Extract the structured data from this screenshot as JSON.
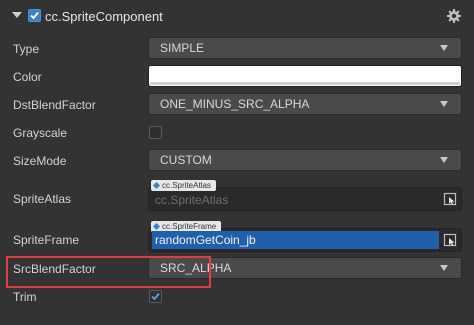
{
  "component": {
    "title": "cc.SpriteComponent",
    "enabled": true
  },
  "properties": {
    "type": {
      "label": "Type",
      "value": "SIMPLE"
    },
    "color": {
      "label": "Color",
      "value": "#ffffff"
    },
    "dst_blend": {
      "label": "DstBlendFactor",
      "value": "ONE_MINUS_SRC_ALPHA"
    },
    "grayscale": {
      "label": "Grayscale",
      "checked": false
    },
    "size_mode": {
      "label": "SizeMode",
      "value": "CUSTOM"
    },
    "sprite_atlas": {
      "label": "SpriteAtlas",
      "tag": "cc.SpriteAtlas",
      "placeholder": "cc.SpriteAtlas"
    },
    "sprite_frame": {
      "label": "SpriteFrame",
      "tag": "cc.SpriteFrame",
      "value": "randomGetCoin_jb"
    },
    "src_blend": {
      "label": "SrcBlendFactor",
      "value": "SRC_ALPHA"
    },
    "trim": {
      "label": "Trim",
      "checked": true
    }
  },
  "icons": {
    "caret": "caret-down-icon",
    "settings": "gear-icon",
    "locate": "locate-asset-icon",
    "dropdown": "dropdown-arrow-icon"
  },
  "colors": {
    "accent": "#3d83c4",
    "selection": "#1f5fae",
    "highlight": "#e23d3d"
  }
}
